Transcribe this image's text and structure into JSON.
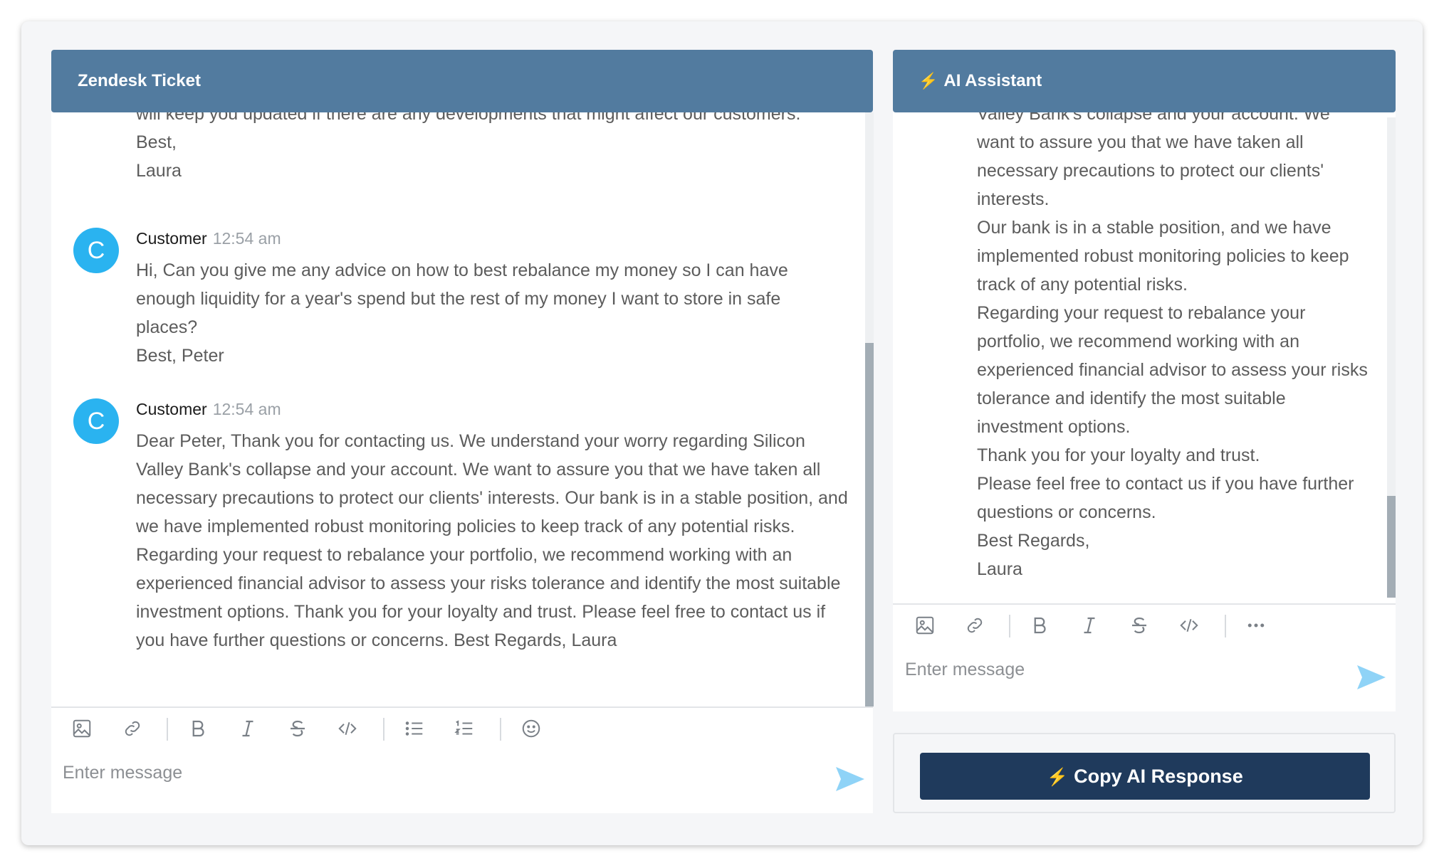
{
  "ticket": {
    "title": "Zendesk Ticket",
    "previous_tail": [
      "will keep you updated if there are any developments that might affect our customers.",
      "Best,",
      "Laura"
    ],
    "messages": [
      {
        "avatar_letter": "C",
        "author": "Customer",
        "time": "12:54 am",
        "lines": [
          "Hi, Can you give me any advice on how to best rebalance my money so I can have enough liquidity for a year's spend but the rest of my money I want to store in safe places?",
          "Best, Peter"
        ]
      },
      {
        "avatar_letter": "C",
        "author": "Customer",
        "time": "12:54 am",
        "lines": [
          "Dear Peter, Thank you for contacting us. We understand your worry regarding Silicon Valley Bank's collapse and your account. We want to assure you that we have taken all necessary precautions to protect our clients' interests. Our bank is in a stable position, and we have implemented robust monitoring policies to keep track of any potential risks. Regarding your request to rebalance your portfolio, we recommend working with an experienced financial advisor to assess your risks tolerance and identify the most suitable investment options. Thank you for your loyalty and trust. Please feel free to contact us if you have further questions or concerns. Best Regards, Laura"
        ]
      }
    ],
    "input_placeholder": "Enter message",
    "toolbar_icons": [
      "image-icon",
      "link-icon",
      "bold-icon",
      "italic-icon",
      "strikethrough-icon",
      "code-icon",
      "bulleted-list-icon",
      "numbered-list-icon",
      "emoji-icon"
    ]
  },
  "assistant": {
    "title": "AI Assistant",
    "title_icon": "lightning-icon",
    "cut_line": "Valley Bank's collapse and your account. We",
    "paragraphs": [
      "want to assure you that we have taken all necessary precautions to protect our clients' interests.",
      "Our bank is in a stable position, and we have implemented robust monitoring policies to keep track of any potential risks.",
      "Regarding your request to rebalance your portfolio, we recommend working with an experienced financial advisor to assess your risks tolerance and identify the most suitable investment options.",
      "Thank you for your loyalty and trust.",
      "Please feel free to contact us if you have further questions or concerns.",
      "Best Regards,",
      "Laura"
    ],
    "input_placeholder": "Enter message",
    "toolbar_icons": [
      "image-icon",
      "link-icon",
      "bold-icon",
      "italic-icon",
      "strikethrough-icon",
      "code-icon",
      "more-icon"
    ],
    "copy_button_label": "Copy AI Response"
  },
  "colors": {
    "header": "#527b9f",
    "avatar": "#2ab3f0",
    "copy_button": "#1f3a5c",
    "send_icon": "#8fd3f7",
    "bolt": "#f6c543"
  }
}
